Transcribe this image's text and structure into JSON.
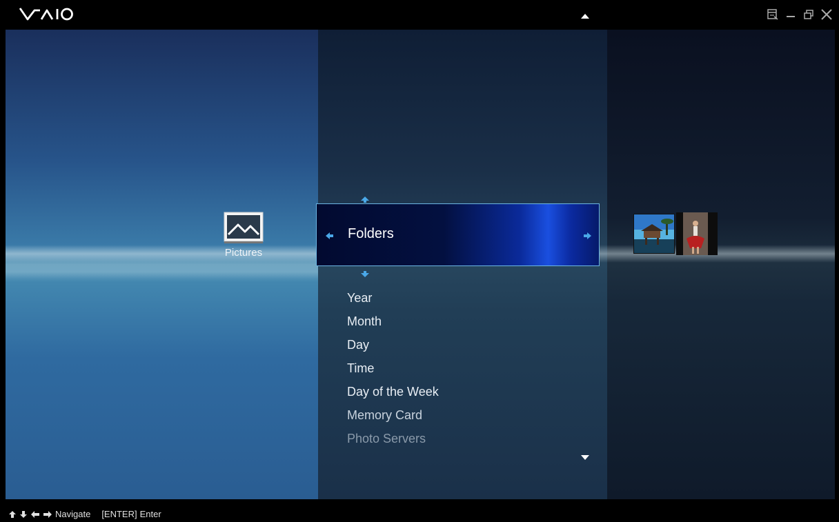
{
  "app": {
    "logo_text": "VAIO"
  },
  "window_controls": {
    "icons": [
      "mode-toggle-icon",
      "minimize-icon",
      "restore-icon",
      "close-icon"
    ]
  },
  "left_panel": {
    "category_label": "Pictures",
    "category_icon": "pictures-icon"
  },
  "menu": {
    "selected": "Folders",
    "items": [
      "Year",
      "Month",
      "Day",
      "Time",
      "Day of the Week",
      "Memory Card",
      "Photo Servers"
    ]
  },
  "footer": {
    "navigate_label": "Navigate",
    "enter_key": "[ENTER]",
    "enter_label": "Enter"
  },
  "colors": {
    "accent": "#4aa8e8",
    "selection_border": "#6cb6e4"
  }
}
